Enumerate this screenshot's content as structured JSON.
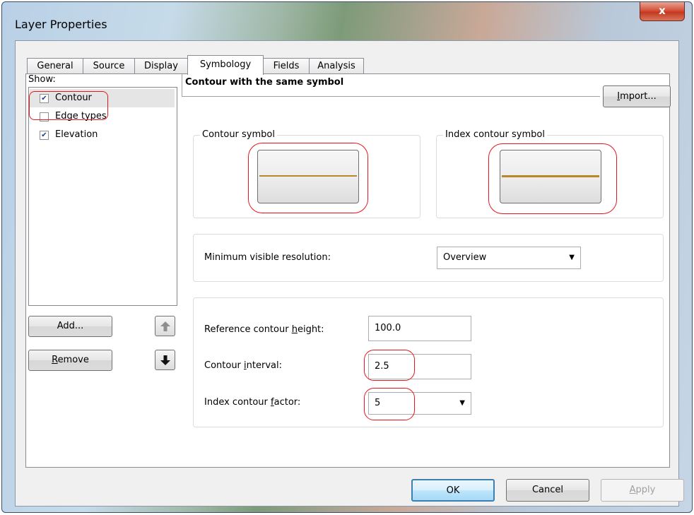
{
  "window": {
    "title": "Layer Properties",
    "close_glyph": "x"
  },
  "tabs": [
    {
      "label": "General"
    },
    {
      "label": "Source"
    },
    {
      "label": "Display"
    },
    {
      "label": "Symbology",
      "active": true
    },
    {
      "label": "Fields"
    },
    {
      "label": "Analysis"
    }
  ],
  "show": {
    "label": "Show:",
    "items": [
      {
        "label": "Contour",
        "checked": true,
        "selected": true
      },
      {
        "label": "Edge types",
        "checked": false
      },
      {
        "label": "Elevation",
        "checked": true
      }
    ],
    "add_label": "Add...",
    "remove_label": "Remove"
  },
  "symbology": {
    "heading": "Contour with the same symbol",
    "import_label": "Import...",
    "contour_symbol_label": "Contour symbol",
    "index_symbol_label": "Index contour symbol",
    "line_color": "#b8862b",
    "min_res_label": "Minimum visible resolution:",
    "min_res_value": "Overview",
    "ref_height_label": "Reference contour height:",
    "ref_height_value": "100.0",
    "interval_label": "Contour interval:",
    "interval_value": "2.5",
    "factor_label": "Index contour factor:",
    "factor_value": "5"
  },
  "footer": {
    "ok_label": "OK",
    "cancel_label": "Cancel",
    "apply_label": "Apply"
  },
  "annotation_color": "#e8161b"
}
